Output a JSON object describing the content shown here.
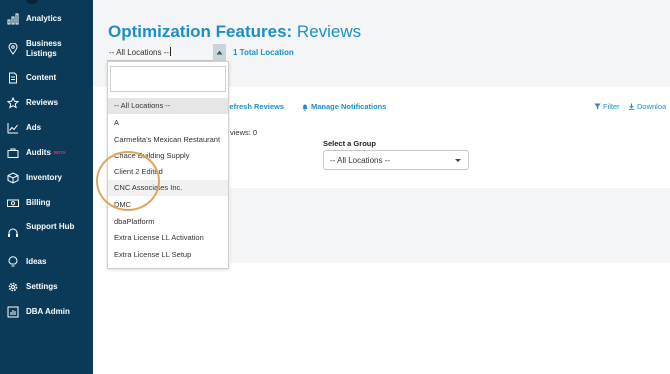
{
  "sidebar": {
    "items": [
      {
        "label": "Analytics",
        "icon": "bar-chart-icon"
      },
      {
        "label": "Business Listings",
        "icon": "location-pin-icon"
      },
      {
        "label": "Content",
        "icon": "document-icon"
      },
      {
        "label": "Reviews",
        "icon": "star-icon"
      },
      {
        "label": "Ads",
        "icon": "line-chart-icon"
      },
      {
        "label": "Audits",
        "icon": "briefcase-icon",
        "badge": "BETA"
      },
      {
        "label": "Inventory",
        "icon": "box-icon"
      },
      {
        "label": "Billing",
        "icon": "money-icon"
      },
      {
        "label": "Support Hub",
        "icon": "headset-icon"
      },
      {
        "label": "Ideas",
        "icon": "lightbulb-icon"
      },
      {
        "label": "Settings",
        "icon": "gear-icon"
      },
      {
        "label": "DBA Admin",
        "icon": "admin-chart-icon"
      }
    ]
  },
  "header": {
    "title_strong": "Optimization Features:",
    "title_rest": " Reviews",
    "location_select_value": "-- All Locations --",
    "total_locations": "1 Total Location"
  },
  "toolbar": {
    "refresh_label": "Refresh Reviews",
    "manage_notifications_label": "Manage Notifications",
    "filter_label": "Filter",
    "download_label": "Downloa"
  },
  "content": {
    "reviews_count_text": "views: 0",
    "group_label": "Select a Group",
    "group_select_value": "-- All Locations --"
  },
  "dropdown": {
    "search_value": "",
    "options": [
      "-- All Locations --",
      "A",
      "Carmelita's Mexican Restaurant",
      "Chace Building Supply",
      "Client 2 Edited",
      "CNC Associates Inc.",
      "DMC",
      "dbaPlatform",
      "Extra License LL Activation",
      "Extra License LL Setup",
      ""
    ],
    "selected_index": 0,
    "hover_index": 5
  },
  "colors": {
    "sidebar_bg": "#0b3a58",
    "accent": "#1d8fc4",
    "annotation": "#e0a55a",
    "beta": "#e0334a"
  }
}
